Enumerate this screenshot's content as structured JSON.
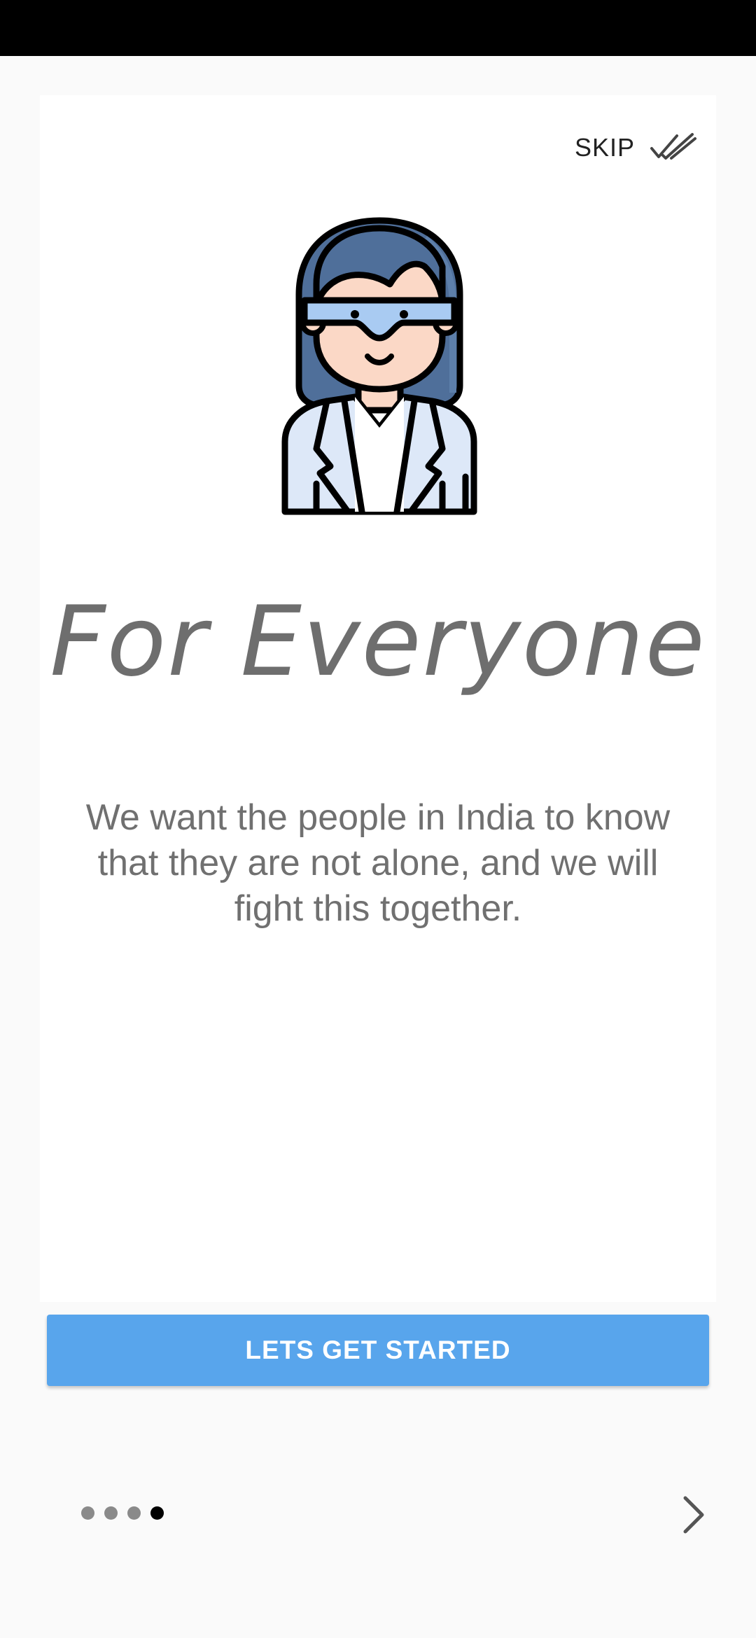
{
  "header": {
    "skip_label": "SKIP",
    "skip_icon": "double-check-icon"
  },
  "onboarding": {
    "illustration": "scientist-woman-with-goggles-icon",
    "title": "For Everyone",
    "description": "We want the people in India to know that they are not alone, and we will fight this together."
  },
  "cta": {
    "label": "LETS GET STARTED",
    "color": "#58a5ec"
  },
  "pager": {
    "total_pages": 4,
    "current_page": 4,
    "next_icon": "chevron-right-icon"
  }
}
